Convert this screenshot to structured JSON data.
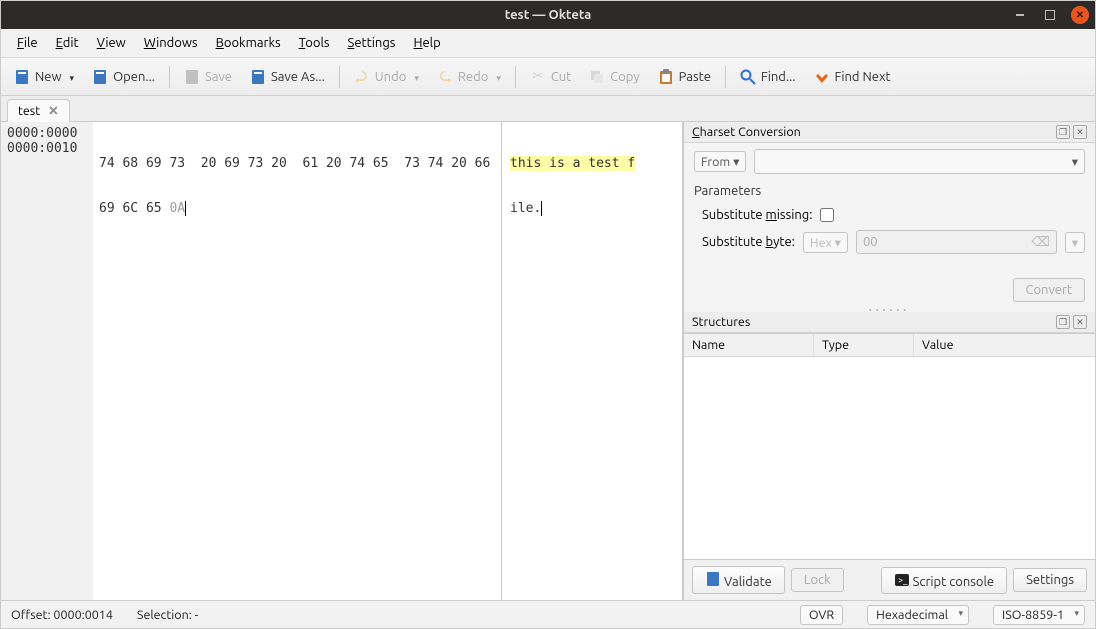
{
  "title": "test — Okteta",
  "menu": [
    "File",
    "Edit",
    "View",
    "Windows",
    "Bookmarks",
    "Tools",
    "Settings",
    "Help"
  ],
  "toolbar": {
    "new": "New",
    "open": "Open...",
    "save": "Save",
    "saveas": "Save As...",
    "undo": "Undo",
    "redo": "Redo",
    "cut": "Cut",
    "copy": "Copy",
    "paste": "Paste",
    "find": "Find...",
    "findnext": "Find Next"
  },
  "tab": {
    "label": "test"
  },
  "hex": {
    "offsets": [
      "0000:0000",
      "0000:0010"
    ],
    "row0": "74 68 69 73  20 69 73 20  61 20 74 65  73 74 20 66",
    "row1_a": "69 6C 65 ",
    "row1_b": "0A",
    "ascii0": "this is a test f",
    "ascii1": "ile."
  },
  "charset": {
    "title": "Charset Conversion",
    "from": "From",
    "params": "Parameters",
    "sub_missing": "Substitute missing:",
    "sub_byte": "Substitute byte:",
    "hex": "Hex",
    "zero": "00",
    "convert": "Convert"
  },
  "structures": {
    "title": "Structures",
    "cols": [
      "Name",
      "Type",
      "Value"
    ],
    "validate": "Validate",
    "lock": "Lock",
    "script": "Script console",
    "settings": "Settings"
  },
  "status": {
    "offset": "Offset: 0000:0014",
    "selection": "Selection: -",
    "ovr": "OVR",
    "base": "Hexadecimal",
    "enc": "ISO-8859-1"
  }
}
